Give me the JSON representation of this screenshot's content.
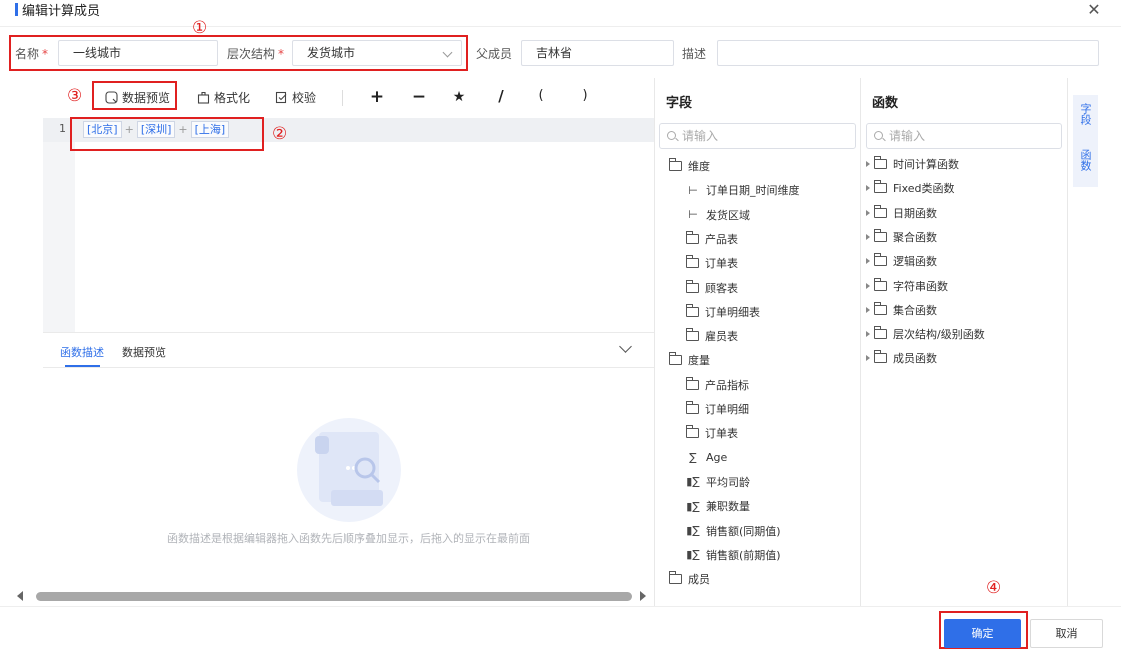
{
  "dialog": {
    "title": "编辑计算成员",
    "close_icon": "close-icon"
  },
  "form": {
    "name_label": "名称",
    "required_mark": "*",
    "name_value": "一线城市",
    "hierarchy_label": "层次结构",
    "hierarchy_value": "发货城市",
    "parent_label": "父成员",
    "parent_value": "吉林省",
    "desc_label": "描述",
    "desc_value": ""
  },
  "toolbar": {
    "preview_label": "数据预览",
    "format_label": "格式化",
    "validate_label": "校验",
    "ops": [
      "+",
      "−",
      "★",
      "/",
      "(",
      ")"
    ]
  },
  "editor": {
    "line_number": "1",
    "tokens": [
      "[北京]",
      "[深圳]",
      "[上海]"
    ],
    "operator": "+"
  },
  "desc_panel": {
    "tabs": [
      "函数描述",
      "数据预览"
    ],
    "active_tab": "函数描述",
    "empty_text": "函数描述是根据编辑器拖入函数先后顺序叠加显示，后拖入的显示在最前面"
  },
  "fields": {
    "title": "字段",
    "search_placeholder": "请输入",
    "items": [
      {
        "label": "维度",
        "icon": "folder-open-icon",
        "level": 0
      },
      {
        "label": "订单日期_时间维度",
        "icon": "hierarchy-icon",
        "level": 1
      },
      {
        "label": "发货区域",
        "icon": "hierarchy-icon",
        "level": 1
      },
      {
        "label": "产品表",
        "icon": "folder-icon",
        "level": 1
      },
      {
        "label": "订单表",
        "icon": "folder-icon",
        "level": 1
      },
      {
        "label": "顾客表",
        "icon": "folder-icon",
        "level": 1
      },
      {
        "label": "订单明细表",
        "icon": "folder-icon",
        "level": 1
      },
      {
        "label": "雇员表",
        "icon": "folder-icon",
        "level": 1
      },
      {
        "label": "度量",
        "icon": "folder-open-icon",
        "level": 0
      },
      {
        "label": "产品指标",
        "icon": "folder-icon",
        "level": 1
      },
      {
        "label": "订单明细",
        "icon": "folder-icon",
        "level": 1
      },
      {
        "label": "订单表",
        "icon": "folder-icon",
        "level": 1
      },
      {
        "label": "Age",
        "icon": "sigma-icon",
        "level": 1
      },
      {
        "label": "平均司龄",
        "icon": "calc-sigma-icon",
        "level": 1
      },
      {
        "label": "兼职数量",
        "icon": "calc-sigma-icon",
        "level": 1
      },
      {
        "label": "销售额(同期值)",
        "icon": "calc-sigma-icon",
        "level": 1
      },
      {
        "label": "销售额(前期值)",
        "icon": "calc-sigma-icon",
        "level": 1
      },
      {
        "label": "成员",
        "icon": "folder-open-icon",
        "level": 0
      }
    ]
  },
  "functions": {
    "title": "函数",
    "search_placeholder": "请输入",
    "items": [
      "时间计算函数",
      "Fixed类函数",
      "日期函数",
      "聚合函数",
      "逻辑函数",
      "字符串函数",
      "集合函数",
      "层次结构/级别函数",
      "成员函数"
    ]
  },
  "side_tabs": [
    "字段",
    "函数"
  ],
  "annotations": [
    "①",
    "②",
    "③",
    "④"
  ],
  "footer": {
    "ok_label": "确定",
    "cancel_label": "取消"
  },
  "colors": {
    "accent": "#2f6fe8",
    "annotation": "#e02020"
  }
}
